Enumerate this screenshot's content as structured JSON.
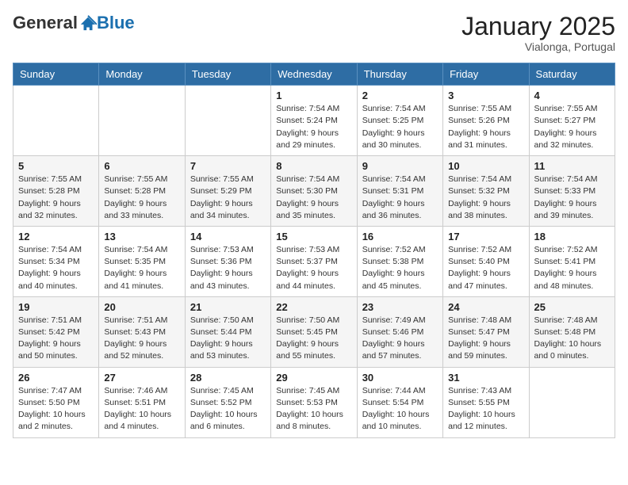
{
  "header": {
    "logo_general": "General",
    "logo_blue": "Blue",
    "month_title": "January 2025",
    "location": "Vialonga, Portugal"
  },
  "days_of_week": [
    "Sunday",
    "Monday",
    "Tuesday",
    "Wednesday",
    "Thursday",
    "Friday",
    "Saturday"
  ],
  "weeks": [
    [
      {
        "day": "",
        "sunrise": "",
        "sunset": "",
        "daylight": ""
      },
      {
        "day": "",
        "sunrise": "",
        "sunset": "",
        "daylight": ""
      },
      {
        "day": "",
        "sunrise": "",
        "sunset": "",
        "daylight": ""
      },
      {
        "day": "1",
        "sunrise": "Sunrise: 7:54 AM",
        "sunset": "Sunset: 5:24 PM",
        "daylight": "Daylight: 9 hours and 29 minutes."
      },
      {
        "day": "2",
        "sunrise": "Sunrise: 7:54 AM",
        "sunset": "Sunset: 5:25 PM",
        "daylight": "Daylight: 9 hours and 30 minutes."
      },
      {
        "day": "3",
        "sunrise": "Sunrise: 7:55 AM",
        "sunset": "Sunset: 5:26 PM",
        "daylight": "Daylight: 9 hours and 31 minutes."
      },
      {
        "day": "4",
        "sunrise": "Sunrise: 7:55 AM",
        "sunset": "Sunset: 5:27 PM",
        "daylight": "Daylight: 9 hours and 32 minutes."
      }
    ],
    [
      {
        "day": "5",
        "sunrise": "Sunrise: 7:55 AM",
        "sunset": "Sunset: 5:28 PM",
        "daylight": "Daylight: 9 hours and 32 minutes."
      },
      {
        "day": "6",
        "sunrise": "Sunrise: 7:55 AM",
        "sunset": "Sunset: 5:28 PM",
        "daylight": "Daylight: 9 hours and 33 minutes."
      },
      {
        "day": "7",
        "sunrise": "Sunrise: 7:55 AM",
        "sunset": "Sunset: 5:29 PM",
        "daylight": "Daylight: 9 hours and 34 minutes."
      },
      {
        "day": "8",
        "sunrise": "Sunrise: 7:54 AM",
        "sunset": "Sunset: 5:30 PM",
        "daylight": "Daylight: 9 hours and 35 minutes."
      },
      {
        "day": "9",
        "sunrise": "Sunrise: 7:54 AM",
        "sunset": "Sunset: 5:31 PM",
        "daylight": "Daylight: 9 hours and 36 minutes."
      },
      {
        "day": "10",
        "sunrise": "Sunrise: 7:54 AM",
        "sunset": "Sunset: 5:32 PM",
        "daylight": "Daylight: 9 hours and 38 minutes."
      },
      {
        "day": "11",
        "sunrise": "Sunrise: 7:54 AM",
        "sunset": "Sunset: 5:33 PM",
        "daylight": "Daylight: 9 hours and 39 minutes."
      }
    ],
    [
      {
        "day": "12",
        "sunrise": "Sunrise: 7:54 AM",
        "sunset": "Sunset: 5:34 PM",
        "daylight": "Daylight: 9 hours and 40 minutes."
      },
      {
        "day": "13",
        "sunrise": "Sunrise: 7:54 AM",
        "sunset": "Sunset: 5:35 PM",
        "daylight": "Daylight: 9 hours and 41 minutes."
      },
      {
        "day": "14",
        "sunrise": "Sunrise: 7:53 AM",
        "sunset": "Sunset: 5:36 PM",
        "daylight": "Daylight: 9 hours and 43 minutes."
      },
      {
        "day": "15",
        "sunrise": "Sunrise: 7:53 AM",
        "sunset": "Sunset: 5:37 PM",
        "daylight": "Daylight: 9 hours and 44 minutes."
      },
      {
        "day": "16",
        "sunrise": "Sunrise: 7:52 AM",
        "sunset": "Sunset: 5:38 PM",
        "daylight": "Daylight: 9 hours and 45 minutes."
      },
      {
        "day": "17",
        "sunrise": "Sunrise: 7:52 AM",
        "sunset": "Sunset: 5:40 PM",
        "daylight": "Daylight: 9 hours and 47 minutes."
      },
      {
        "day": "18",
        "sunrise": "Sunrise: 7:52 AM",
        "sunset": "Sunset: 5:41 PM",
        "daylight": "Daylight: 9 hours and 48 minutes."
      }
    ],
    [
      {
        "day": "19",
        "sunrise": "Sunrise: 7:51 AM",
        "sunset": "Sunset: 5:42 PM",
        "daylight": "Daylight: 9 hours and 50 minutes."
      },
      {
        "day": "20",
        "sunrise": "Sunrise: 7:51 AM",
        "sunset": "Sunset: 5:43 PM",
        "daylight": "Daylight: 9 hours and 52 minutes."
      },
      {
        "day": "21",
        "sunrise": "Sunrise: 7:50 AM",
        "sunset": "Sunset: 5:44 PM",
        "daylight": "Daylight: 9 hours and 53 minutes."
      },
      {
        "day": "22",
        "sunrise": "Sunrise: 7:50 AM",
        "sunset": "Sunset: 5:45 PM",
        "daylight": "Daylight: 9 hours and 55 minutes."
      },
      {
        "day": "23",
        "sunrise": "Sunrise: 7:49 AM",
        "sunset": "Sunset: 5:46 PM",
        "daylight": "Daylight: 9 hours and 57 minutes."
      },
      {
        "day": "24",
        "sunrise": "Sunrise: 7:48 AM",
        "sunset": "Sunset: 5:47 PM",
        "daylight": "Daylight: 9 hours and 59 minutes."
      },
      {
        "day": "25",
        "sunrise": "Sunrise: 7:48 AM",
        "sunset": "Sunset: 5:48 PM",
        "daylight": "Daylight: 10 hours and 0 minutes."
      }
    ],
    [
      {
        "day": "26",
        "sunrise": "Sunrise: 7:47 AM",
        "sunset": "Sunset: 5:50 PM",
        "daylight": "Daylight: 10 hours and 2 minutes."
      },
      {
        "day": "27",
        "sunrise": "Sunrise: 7:46 AM",
        "sunset": "Sunset: 5:51 PM",
        "daylight": "Daylight: 10 hours and 4 minutes."
      },
      {
        "day": "28",
        "sunrise": "Sunrise: 7:45 AM",
        "sunset": "Sunset: 5:52 PM",
        "daylight": "Daylight: 10 hours and 6 minutes."
      },
      {
        "day": "29",
        "sunrise": "Sunrise: 7:45 AM",
        "sunset": "Sunset: 5:53 PM",
        "daylight": "Daylight: 10 hours and 8 minutes."
      },
      {
        "day": "30",
        "sunrise": "Sunrise: 7:44 AM",
        "sunset": "Sunset: 5:54 PM",
        "daylight": "Daylight: 10 hours and 10 minutes."
      },
      {
        "day": "31",
        "sunrise": "Sunrise: 7:43 AM",
        "sunset": "Sunset: 5:55 PM",
        "daylight": "Daylight: 10 hours and 12 minutes."
      },
      {
        "day": "",
        "sunrise": "",
        "sunset": "",
        "daylight": ""
      }
    ]
  ]
}
